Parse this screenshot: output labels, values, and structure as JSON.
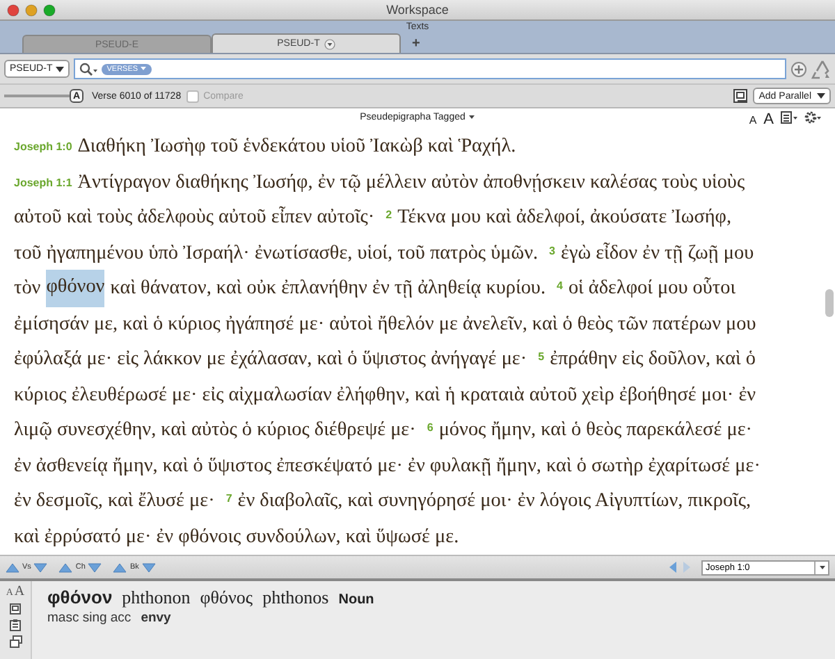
{
  "window": {
    "title": "Workspace"
  },
  "section_title": "Texts",
  "tabs": [
    {
      "label": "PSEUD-E",
      "selected": false
    },
    {
      "label": "PSEUD-T",
      "selected": true
    }
  ],
  "add_tab": "+",
  "toolbar": {
    "module": "PSEUD-T",
    "search_token": "VERSES",
    "font_size_slider": {
      "thumb": "A",
      "level": 1
    },
    "verse_label": "Verse 6010 of 11728",
    "compare": {
      "label": "Compare",
      "checked": false,
      "disabled": true
    },
    "add_parallel": "Add Parallel"
  },
  "text_header": {
    "title": "Pseudepigrapha Tagged",
    "font_buttons": [
      "A",
      "A"
    ]
  },
  "lines": [
    [
      {
        "kind": "ref",
        "text": "Joseph 1:0"
      },
      {
        "kind": "text",
        "text": "Διαθήκη Ἰωσὴφ τοῦ ἑνδεκάτου υἱοῦ Ἰακὼβ καὶ Ῥαχήλ."
      }
    ],
    [
      {
        "kind": "ref",
        "text": "Joseph 1:1"
      },
      {
        "kind": "text",
        "text": "Ἀντίγραγον διαθήκης Ἰωσήφ, ἐν τῷ μέλλειν αὐτὸν ἀποθνῄσκειν καλέσας τοὺς υἱοὺς"
      }
    ],
    [
      {
        "kind": "text",
        "text": "αὐτοῦ καὶ τοὺς ἀδελφοὺς αὐτοῦ εἶπεν αὐτοῖς·"
      },
      {
        "kind": "verse",
        "text": "2"
      },
      {
        "kind": "text",
        "text": "Τέκνα μου καὶ ἀδελφοί, ἀκούσατε Ἰωσήφ,"
      }
    ],
    [
      {
        "kind": "text",
        "text": "τοῦ ἠγαπημένου ὑπὸ Ἰσραήλ· ἐνωτίσασθε, υἱοί, τοῦ πατρὸς ὑμῶν."
      },
      {
        "kind": "verse",
        "text": "3"
      },
      {
        "kind": "text",
        "text": "ἐγὼ εἶδον ἐν τῇ ζωῇ μου"
      }
    ],
    [
      {
        "kind": "text",
        "text": "τὸν"
      },
      {
        "kind": "word",
        "text": "φθόνον",
        "selected": true
      },
      {
        "kind": "text",
        "text": "καὶ θάνατον, καὶ οὐκ ἐπλανήθην ἐν τῇ ἀληθείᾳ κυρίου."
      },
      {
        "kind": "verse",
        "text": "4"
      },
      {
        "kind": "text",
        "text": "οἱ ἀδελφοί μου οὗτοι"
      }
    ],
    [
      {
        "kind": "text",
        "text": "ἐμίσησάν με, καὶ ὁ κύριος ἠγάπησέ με· αὐτοὶ ἤθελόν με ἀνελεῖν, καὶ ὁ θεὸς τῶν πατέρων μου"
      }
    ],
    [
      {
        "kind": "text",
        "text": "ἐφύλαξά με· εἰς λάκκον με ἐχάλασαν, καὶ ὁ ὕψιστος ἀνήγαγέ με·"
      },
      {
        "kind": "verse",
        "text": "5"
      },
      {
        "kind": "text",
        "text": "ἐπράθην εἰς δοῦλον, καὶ ὁ"
      }
    ],
    [
      {
        "kind": "text",
        "text": "κύριος ἐλευθέρωσέ με· εἰς αἰχμαλωσίαν ἐλήφθην, καὶ ἡ κραταιὰ αὐτοῦ χεὶρ ἐβοήθησέ μοι· ἐν"
      }
    ],
    [
      {
        "kind": "text",
        "text": "λιμῷ συνεσχέθην, καὶ αὐτὸς ὁ κύριος διέθρεψέ με·"
      },
      {
        "kind": "verse",
        "text": "6"
      },
      {
        "kind": "text",
        "text": "μόνος ἤμην, καὶ ὁ θεὸς παρεκάλεσέ με·"
      }
    ],
    [
      {
        "kind": "text",
        "text": "ἐν ἀσθενείᾳ ἤμην, καὶ ὁ ὕψιστος ἐπεσκέψατό με· ἐν φυλακῇ ἤμην, καὶ ὁ σωτὴρ ἐχαρίτωσέ με·"
      }
    ],
    [
      {
        "kind": "text",
        "text": "ἐν δεσμοῖς, καὶ ἔλυσέ με·"
      },
      {
        "kind": "verse",
        "text": "7"
      },
      {
        "kind": "text",
        "text": "ἐν διαβολαῖς, καὶ συνηγόρησέ μοι· ἐν λόγοις Αἰγυπτίων, πικροῖς,"
      }
    ],
    [
      {
        "kind": "text",
        "text": "καὶ ἐρρύσατό με· ἐν φθόνοις συνδούλων, καὶ ὕψωσέ με."
      }
    ]
  ],
  "nav": {
    "buttons": [
      "Vs",
      "Ch",
      "Bk"
    ],
    "reference": "Joseph 1:0"
  },
  "info": {
    "font_buttons": [
      "A",
      "A"
    ],
    "word": "φθόνον",
    "translit": "phthonon",
    "lemma": "φθόνος",
    "lemma_translit": "phthonos",
    "part_of_speech": "Noun",
    "parsing": "masc sing acc",
    "gloss": "envy"
  }
}
